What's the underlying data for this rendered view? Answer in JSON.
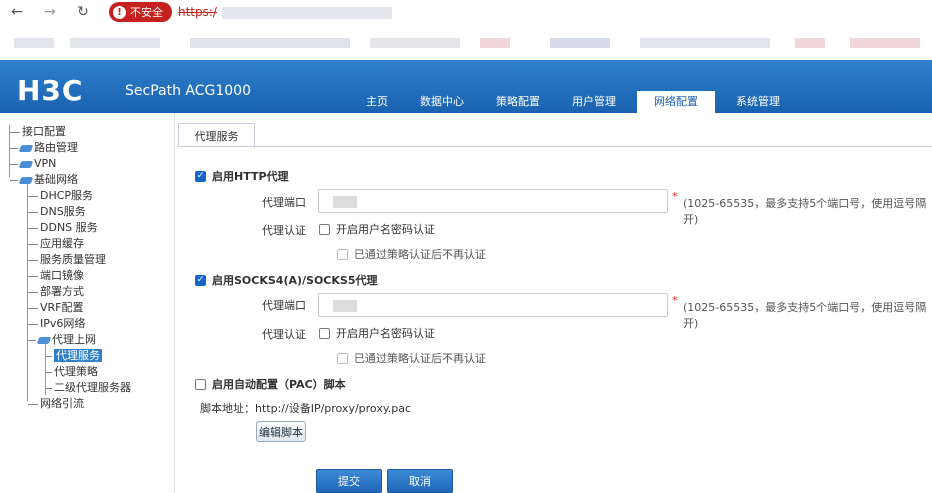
{
  "browser": {
    "insecure_label": "不安全",
    "url_text": "https:/"
  },
  "header": {
    "logo": "H3C",
    "product": "SecPath ACG1000",
    "menu": [
      "主页",
      "数据中心",
      "策略配置",
      "用户管理",
      "网络配置",
      "系统管理"
    ],
    "active_menu": "网络配置"
  },
  "sidebar": {
    "items": [
      {
        "label": "接口配置"
      },
      {
        "label": "路由管理"
      },
      {
        "label": "VPN"
      },
      {
        "label": "基础网络"
      },
      {
        "label": "DHCP服务"
      },
      {
        "label": "DNS服务"
      },
      {
        "label": "DDNS 服务"
      },
      {
        "label": "应用缓存"
      },
      {
        "label": "服务质量管理"
      },
      {
        "label": "端口镜像"
      },
      {
        "label": "部署方式"
      },
      {
        "label": "VRF配置"
      },
      {
        "label": "IPv6网络"
      },
      {
        "label": "代理上网"
      },
      {
        "label": "代理服务"
      },
      {
        "label": "代理策略"
      },
      {
        "label": "二级代理服务器"
      },
      {
        "label": "网络引流"
      }
    ],
    "selected": "代理服务"
  },
  "content": {
    "tab_label": "代理服务",
    "http": {
      "enable_label": "启用HTTP代理",
      "enabled": true,
      "port_label": "代理端口",
      "required_mark": "*",
      "port_hint": "(1025-65535，最多支持5个端口号，使用逗号隔开)",
      "auth_label": "代理认证",
      "auth_option": "开启用户名密码认证",
      "skip_option": "已通过策略认证后不再认证"
    },
    "socks": {
      "enable_label": "启用SOCKS4(A)/SOCKS5代理",
      "enabled": true,
      "port_label": "代理端口",
      "required_mark": "*",
      "port_hint": "(1025-65535，最多支持5个端口号，使用逗号隔开)",
      "auth_label": "代理认证",
      "auth_option": "开启用户名密码认证",
      "skip_option": "已通过策略认证后不再认证"
    },
    "pac": {
      "enable_label": "启用自动配置（PAC）脚本",
      "enabled": false,
      "script_addr": "脚本地址：http://设备IP/proxy/proxy.pac",
      "edit_button": "编辑脚本"
    },
    "submit": "提交",
    "cancel": "取消"
  }
}
